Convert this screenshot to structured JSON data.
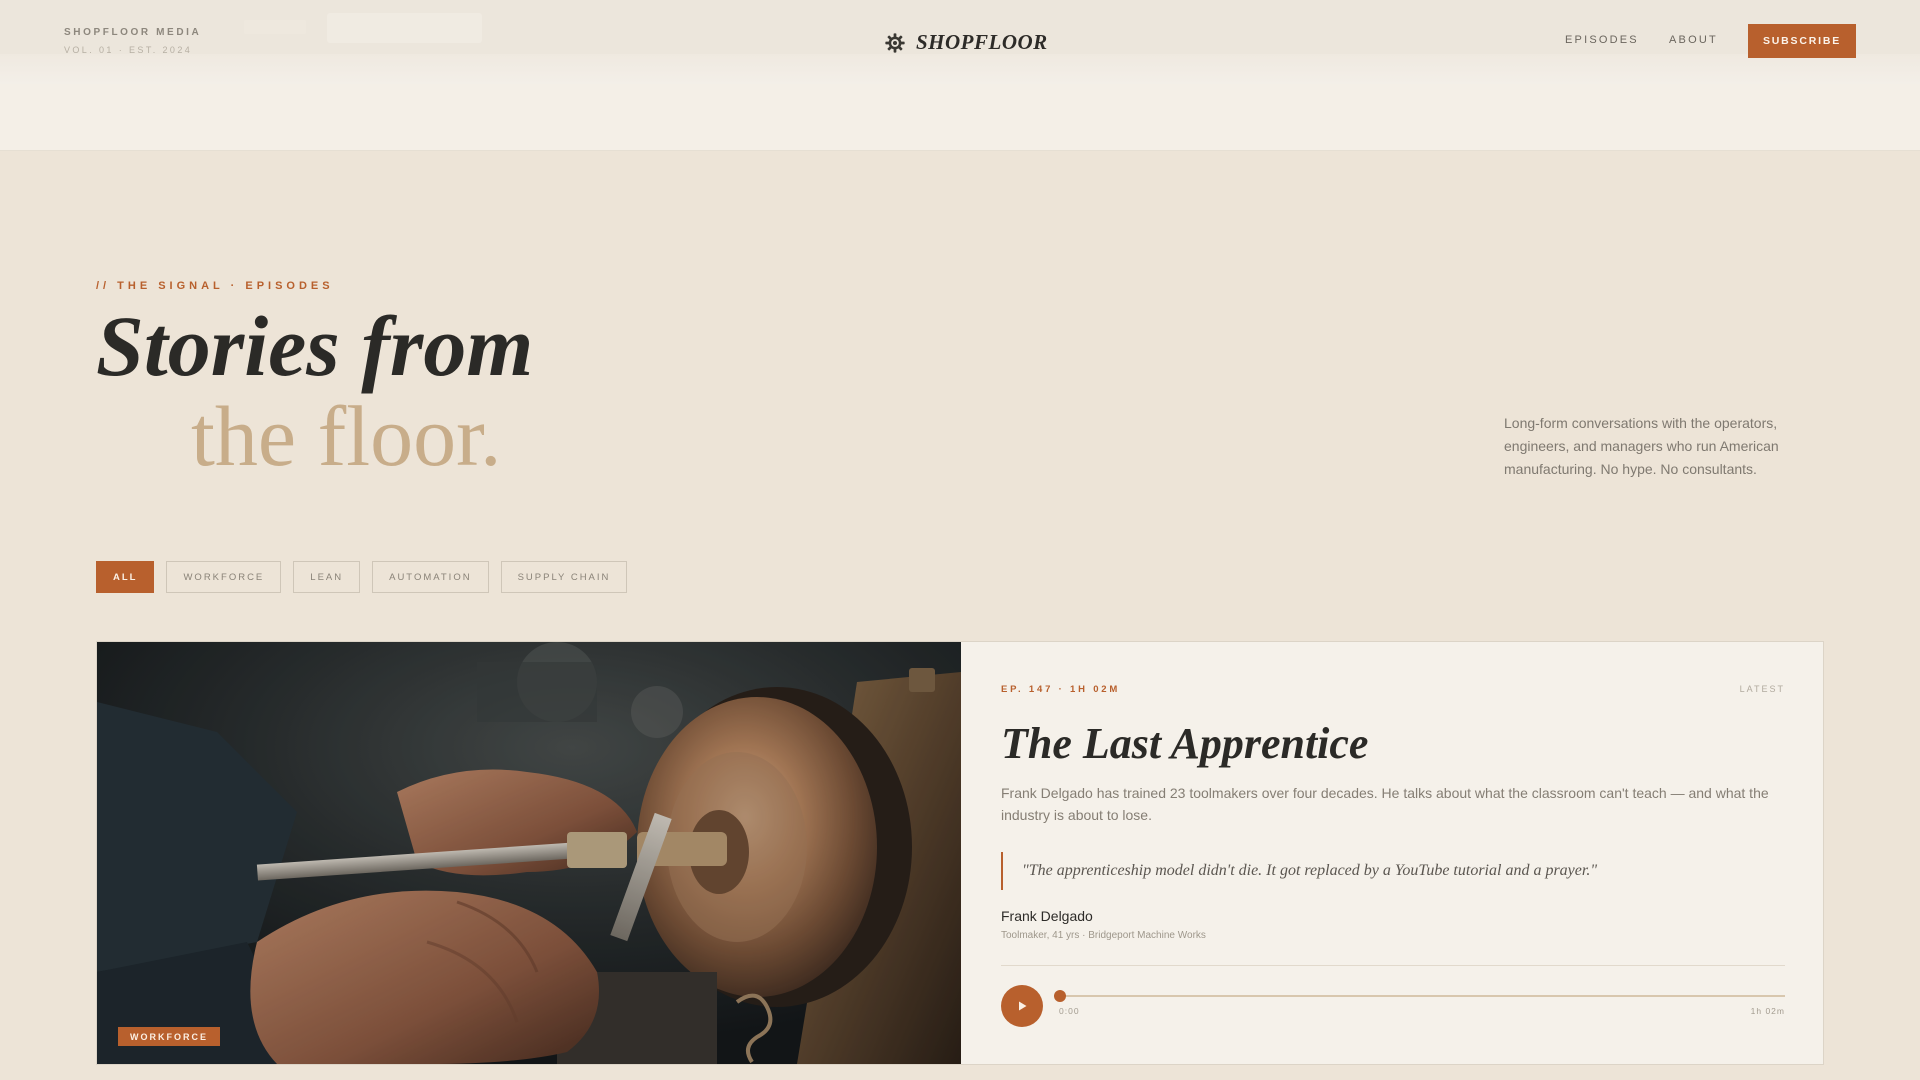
{
  "header": {
    "org": "SHOPFLOOR MEDIA",
    "volume": "VOL. 01 · EST. 2024",
    "logo_text": "SHOPFLOOR",
    "logo_icon": "gear-icon",
    "nav": {
      "episodes": "EPISODES",
      "about": "ABOUT"
    },
    "subscribe": "SUBSCRIBE"
  },
  "hero": {
    "eyebrow": "// THE SIGNAL · EPISODES",
    "title_line1": "Stories from",
    "title_line2": "the floor.",
    "intro": "Long-form conversations with the operators, engineers, and managers who run American manufacturing. No hype. No consultants."
  },
  "filters": {
    "items": [
      "ALL",
      "WORKFORCE",
      "LEAN",
      "AUTOMATION",
      "SUPPLY CHAIN"
    ],
    "active": "ALL"
  },
  "featured": {
    "category_tag": "WORKFORCE",
    "episode_meta": "EP. 147 · 1H 02M",
    "badge": "LATEST",
    "title": "The Last Apprentice",
    "description": "Frank Delgado has trained 23 toolmakers over four decades. He talks about what the classroom can't teach — and what the industry is about to lose.",
    "quote": "\"The apprenticeship model didn't die. It got replaced by a YouTube tutorial and a prayer.\"",
    "guest_name": "Frank Delgado",
    "guest_role": "Toolmaker, 41 yrs · Bridgeport Machine Works",
    "player": {
      "current": "0:00",
      "duration": "1h 02m",
      "progress": 0.0
    }
  },
  "colors": {
    "accent": "#b8602d",
    "background": "#ede4d7",
    "card": "#f5f1ea",
    "title_secondary": "#c8ad8a"
  }
}
